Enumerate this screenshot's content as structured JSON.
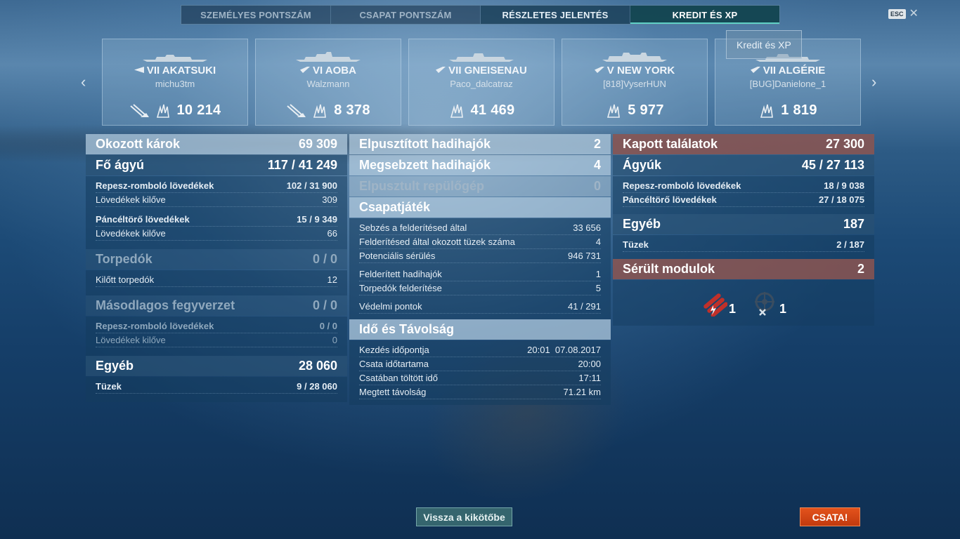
{
  "tabs": [
    "SZEMÉLYES PONTSZÁM",
    "CSAPAT PONTSZÁM",
    "RÉSZLETES JELENTÉS",
    "KREDIT ÉS XP"
  ],
  "esc_label": "ESC",
  "tooltip": "Kredit és XP",
  "ships": [
    {
      "name": "VII AKATSUKI",
      "player": "michu3tm",
      "damage": "10 214"
    },
    {
      "name": "VI AOBA",
      "player": "Walzmann",
      "damage": "8 378"
    },
    {
      "name": "VII GNEISENAU",
      "player": "Paco_dalcatraz",
      "damage": "41 469"
    },
    {
      "name": "V NEW YORK",
      "player": "[818]VyserHUN",
      "damage": "5 977"
    },
    {
      "name": "VII ALGÉRIE",
      "player": "[BUG]Danielone_1",
      "damage": "1 819"
    }
  ],
  "left": {
    "dealt": {
      "label": "Okozott károk",
      "value": "69 309"
    },
    "main": {
      "label": "Fő ágyú",
      "value": "117 / 41 249"
    },
    "he": {
      "label": "Repesz-romboló lövedékek",
      "value": "102 / 31 900"
    },
    "he_fired": {
      "label": "Lövedékek kilőve",
      "value": "309"
    },
    "ap": {
      "label": "Páncéltörő lövedékek",
      "value": "15 / 9 349"
    },
    "ap_fired": {
      "label": "Lövedékek kilőve",
      "value": "66"
    },
    "torp": {
      "label": "Torpedók",
      "value": "0 / 0"
    },
    "torp_fired": {
      "label": "Kilőtt torpedók",
      "value": "12"
    },
    "sec": {
      "label": "Másodlagos fegyverzet",
      "value": "0 / 0"
    },
    "sec_he": {
      "label": "Repesz-romboló lövedékek",
      "value": "0 / 0"
    },
    "sec_fired": {
      "label": "Lövedékek kilőve",
      "value": "0"
    },
    "other": {
      "label": "Egyéb",
      "value": "28 060"
    },
    "fires": {
      "label": "Tüzek",
      "value": "9 / 28 060"
    }
  },
  "mid": {
    "destroyed": {
      "label": "Elpusztított hadihajók",
      "value": "2"
    },
    "damaged": {
      "label": "Megsebzett hadihajók",
      "value": "4"
    },
    "planes": {
      "label": "Elpusztult repülőgép",
      "value": "0"
    },
    "team": {
      "label": "Csapatjáték"
    },
    "spot_dmg": {
      "label": "Sebzés a felderítésed által",
      "value": "33 656"
    },
    "spot_fires": {
      "label": "Felderítésed által okozott tüzek száma",
      "value": "4"
    },
    "potential": {
      "label": "Potenciális sérülés",
      "value": "946 731"
    },
    "spotted": {
      "label": "Felderített hadihajók",
      "value": "1"
    },
    "torp_spot": {
      "label": "Torpedók felderítése",
      "value": "5"
    },
    "defense": {
      "label": "Védelmi pontok",
      "value": "41 / 291"
    },
    "time": {
      "label": "Idő és Távolság"
    },
    "start": {
      "label": "Kezdés időpontja",
      "value": "20:01  07.08.2017"
    },
    "duration": {
      "label": "Csata időtartama",
      "value": "20:00"
    },
    "in_battle": {
      "label": "Csatában töltött idő",
      "value": "17:11"
    },
    "distance": {
      "label": "Megtett távolság",
      "value": "71.21 km"
    }
  },
  "right": {
    "received": {
      "label": "Kapott találatok",
      "value": "27 300"
    },
    "guns": {
      "label": "Ágyúk",
      "value": "45 / 27 113"
    },
    "he": {
      "label": "Repesz-romboló lövedékek",
      "value": "18 / 9 038"
    },
    "ap": {
      "label": "Páncéltörő lövedékek",
      "value": "27 / 18 075"
    },
    "other": {
      "label": "Egyéb",
      "value": "187"
    },
    "fires": {
      "label": "Tüzek",
      "value": "2 / 187"
    },
    "modules": {
      "label": "Sérült modulok",
      "value": "2"
    },
    "mod1_count": "1",
    "mod2_count": "1"
  },
  "buttons": {
    "port": "Vissza a kikötőbe",
    "battle": "CSATA!"
  },
  "colors": {
    "battle": "#d8461a",
    "received_header": "#8c5550",
    "active_tab": "#5fd0c6"
  }
}
